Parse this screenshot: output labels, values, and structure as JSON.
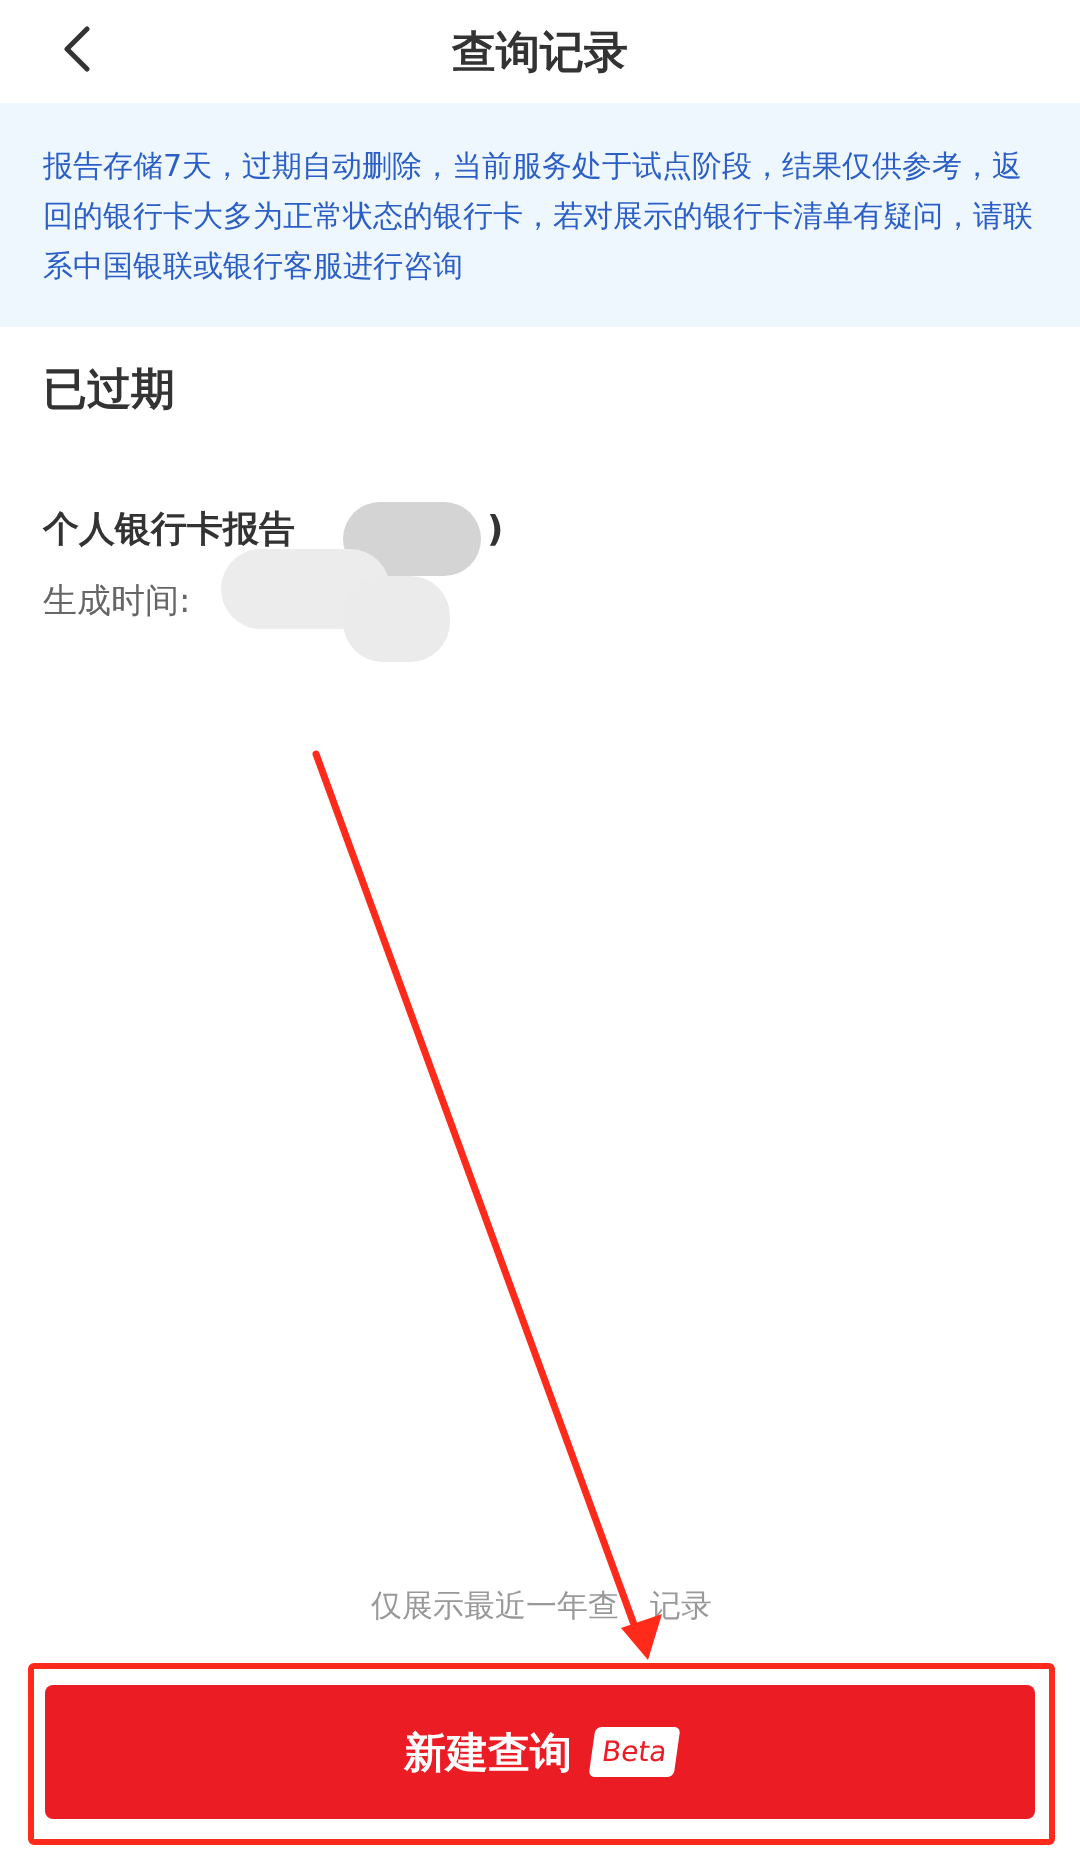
{
  "header": {
    "title": "查询记录"
  },
  "notice": "报告存储7天，过期自动删除，当前服务处于试点阶段，结果仅供参考，返回的银行卡大多为正常状态的银行卡，若对展示的银行卡清单有疑问，请联系中国银联或银行客服进行咨询",
  "section": {
    "title": "已过期",
    "items": [
      {
        "title": "个人银行卡报告",
        "title_tail": ")",
        "time_label": "生成时间:",
        "redacted": true
      }
    ]
  },
  "footer_note": [
    "仅展示最近一年查",
    "记录"
  ],
  "primary_button": {
    "label": "新建查询",
    "badge": "Beta"
  },
  "annotations": {
    "arrow": true,
    "frame": true
  }
}
